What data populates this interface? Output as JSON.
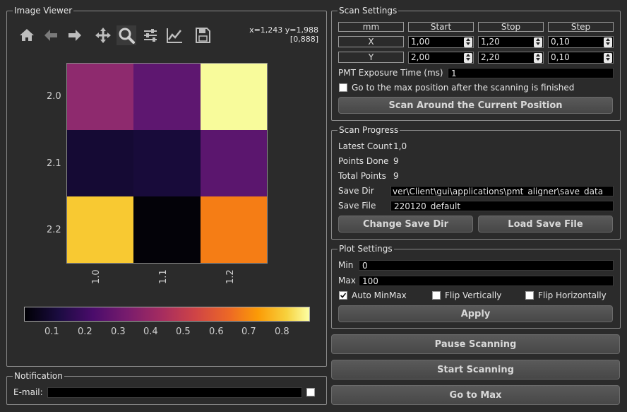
{
  "image_viewer": {
    "title": "Image Viewer",
    "coords_line1": "x=1,243 y=1,988",
    "coords_line2": "[0,888]",
    "toolbar": [
      "home-icon",
      "back-arrow-icon",
      "forward-arrow-icon",
      "pan-icon",
      "zoom-icon",
      "configure-subplots-icon",
      "edit-axis-icon",
      "save-icon"
    ],
    "y_ticks": [
      "2.0",
      "2.1",
      "2.2"
    ],
    "x_ticks": [
      "1.0",
      "1.1",
      "1.2"
    ],
    "heatmap_colors": [
      [
        "#8e2a6e",
        "#5e1770",
        "#f8fb9b"
      ],
      [
        "#150a34",
        "#180b3a",
        "#5b166e"
      ],
      [
        "#f8c932",
        "#030208",
        "#f57d15"
      ]
    ],
    "colorbar_ticks": [
      "0.1",
      "0.2",
      "0.3",
      "0.4",
      "0.5",
      "0.6",
      "0.7",
      "0.8"
    ]
  },
  "notification": {
    "title": "Notification",
    "email_label": "E-mail:",
    "email_value": ""
  },
  "scan_settings": {
    "title": "Scan Settings",
    "headers": [
      "mm",
      "Start",
      "Stop",
      "Step"
    ],
    "rows": [
      {
        "axis": "X",
        "start": "1,00",
        "stop": "1,20",
        "step": "0,10"
      },
      {
        "axis": "Y",
        "start": "2,00",
        "stop": "2,20",
        "step": "0,10"
      }
    ],
    "pmt_label": "PMT Exposure Time (ms)",
    "pmt_value": "1",
    "goto_max_label": "Go to the max position after the scanning is finished",
    "goto_max_checked": false,
    "scan_button": "Scan Around the Current Position"
  },
  "scan_progress": {
    "title": "Scan Progress",
    "latest_count_label": "Latest Count",
    "latest_count": "1,0",
    "points_done_label": "Points Done",
    "points_done": "9",
    "total_points_label": "Total Points",
    "total_points": "9",
    "save_dir_label": "Save Dir",
    "save_dir": "ver\\Client\\gui\\applications\\pmt_aligner\\save_data",
    "save_file_label": "Save File",
    "save_file": "220120_default",
    "change_dir_button": "Change Save Dir",
    "load_file_button": "Load Save File"
  },
  "plot_settings": {
    "title": "Plot Settings",
    "min_label": "Min",
    "min_value": "0",
    "max_label": "Max",
    "max_value": "100",
    "auto_minmax_label": "Auto MinMax",
    "auto_minmax_checked": true,
    "flip_v_label": "Flip Vertically",
    "flip_v_checked": false,
    "flip_h_label": "Flip Horizontally",
    "flip_h_checked": false,
    "apply_button": "Apply"
  },
  "actions": {
    "pause": "Pause Scanning",
    "start": "Start Scanning",
    "goto_max": "Go to Max"
  }
}
